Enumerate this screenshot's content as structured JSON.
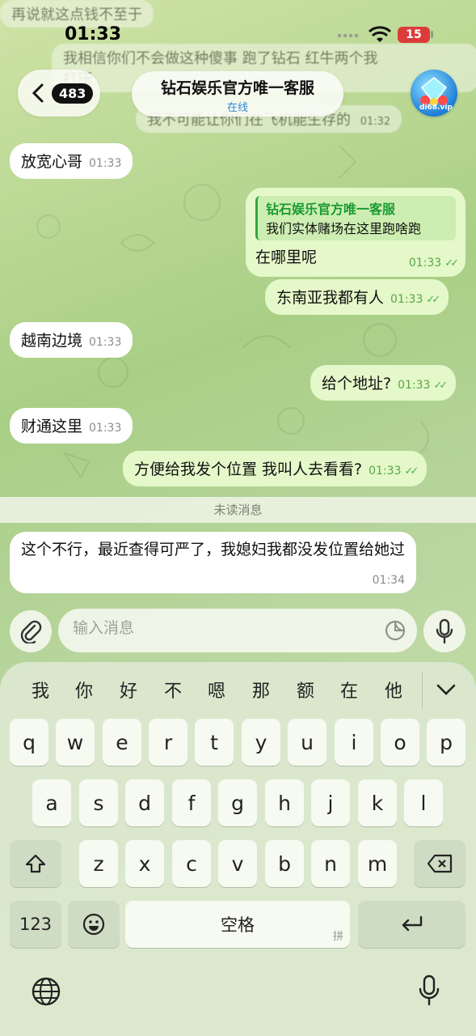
{
  "status": {
    "time": "01:33",
    "battery": "15"
  },
  "ghost_messages": [
    "再说就这点钱不至于",
    "我相信你们不会做这种傻事 跑了钻石 红牛两个我",
    "打压",
    "我不可能让你们在飞机能生存的",
    "01:32"
  ],
  "header": {
    "back_count": "483",
    "title": "钻石娱乐官方唯一客服",
    "subtitle": "在线",
    "avatar_label": "di68.vip"
  },
  "messages": [
    {
      "side": "in",
      "text": "放宽心哥",
      "time": "01:33"
    },
    {
      "side": "out",
      "reply_name": "钻石娱乐官方唯一客服",
      "reply_text": "我们实体赌场在这里跑啥跑",
      "text": "在哪里呢",
      "time": "01:33"
    },
    {
      "side": "out",
      "text": "东南亚我都有人",
      "time": "01:33"
    },
    {
      "side": "in",
      "text": "越南边境",
      "time": "01:33"
    },
    {
      "side": "out",
      "text": "给个地址?",
      "time": "01:33"
    },
    {
      "side": "in",
      "text": "财通这里",
      "time": "01:33"
    },
    {
      "side": "out",
      "text": "方便给我发个位置 我叫人去看看?",
      "time": "01:33"
    },
    {
      "side": "in",
      "text": "这个不行，最近查得可严了，我媳妇我都没发位置给她过",
      "time": "01:34"
    }
  ],
  "unread_label": "未读消息",
  "input": {
    "placeholder": "输入消息"
  },
  "keyboard": {
    "candidates": [
      "我",
      "你",
      "好",
      "不",
      "嗯",
      "那",
      "额",
      "在",
      "他"
    ],
    "row1": [
      "q",
      "w",
      "e",
      "r",
      "t",
      "y",
      "u",
      "i",
      "o",
      "p"
    ],
    "row2": [
      "a",
      "s",
      "d",
      "f",
      "g",
      "h",
      "j",
      "k",
      "l"
    ],
    "row3": [
      "z",
      "x",
      "c",
      "v",
      "b",
      "n",
      "m"
    ],
    "numbers_key": "123",
    "space_label": "空格",
    "space_hint": "拼"
  }
}
